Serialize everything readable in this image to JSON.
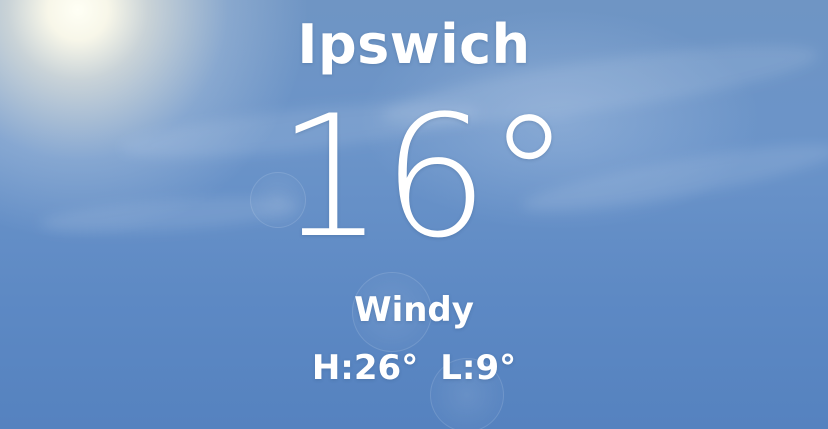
{
  "weather": {
    "city": "Ipswich",
    "temperature": "16°",
    "condition": "Windy",
    "high": "H:26°",
    "low": "L:9°"
  },
  "colors": {
    "sky_top": "#6f95c4",
    "sky_bottom": "#5582bf",
    "text": "#ffffff"
  }
}
